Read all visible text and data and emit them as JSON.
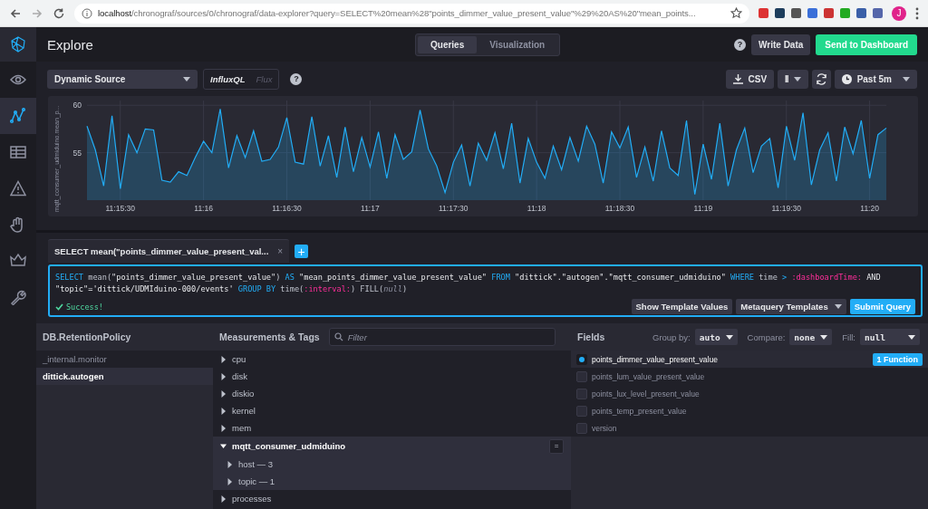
{
  "browser": {
    "url_host": "localhost",
    "url_path": "/chronograf/sources/0/chronograf/data-explorer?query=SELECT%20mean%28\"points_dimmer_value_present_value\"%29%20AS%20\"mean_points...",
    "avatar": "J"
  },
  "sidebar": {
    "items": [
      {
        "selected": false
      },
      {
        "selected": true
      },
      {
        "selected": false
      },
      {
        "selected": false
      },
      {
        "selected": false
      },
      {
        "selected": false
      },
      {
        "selected": false
      }
    ]
  },
  "header": {
    "title": "Explore",
    "tabs": [
      {
        "label": "Queries",
        "selected": true
      },
      {
        "label": "Visualization",
        "selected": false
      }
    ],
    "help": "?",
    "write_data": "Write Data",
    "send": "Send to Dashboard"
  },
  "toolbar": {
    "source": "Dynamic Source",
    "languages": [
      {
        "label": "InfluxQL",
        "selected": true
      },
      {
        "label": "Flux",
        "selected": false
      }
    ],
    "help": "?",
    "csv": "CSV",
    "pause": "II",
    "range": "Past 5m"
  },
  "chart": {
    "chart_data": {
      "type": "area",
      "ylabel": "mqtt_consumer_udmiduino.mean_p...",
      "ylim": [
        50,
        60.5
      ],
      "yticks": [
        55,
        60
      ],
      "grid": true,
      "categories": [
        null,
        null,
        null,
        null,
        "11:15:30",
        null,
        null,
        null,
        null,
        null,
        null,
        null,
        null,
        null,
        "11:16",
        null,
        null,
        null,
        null,
        null,
        null,
        null,
        null,
        null,
        "11:16:30",
        null,
        null,
        null,
        null,
        null,
        null,
        null,
        null,
        null,
        "11:17",
        null,
        null,
        null,
        null,
        null,
        null,
        null,
        null,
        null,
        "11:17:30",
        null,
        null,
        null,
        null,
        null,
        null,
        null,
        null,
        null,
        "11:18",
        null,
        null,
        null,
        null,
        null,
        null,
        null,
        null,
        null,
        "11:18:30",
        null,
        null,
        null,
        null,
        null,
        null,
        null,
        null,
        null,
        "11:19",
        null,
        null,
        null,
        null,
        null,
        null,
        null,
        null,
        null,
        "11:19:30",
        null,
        null,
        null,
        null,
        null,
        null,
        null,
        null,
        null,
        "11:20",
        null,
        null
      ],
      "series": [
        {
          "color": "#22adf6",
          "values": [
            57.8,
            55.3,
            51.5,
            58.9,
            51.2,
            56.9,
            55.0,
            57.5,
            57.4,
            52.1,
            51.9,
            53.0,
            52.6,
            54.5,
            56.2,
            55.0,
            59.6,
            53.4,
            56.8,
            54.5,
            57.3,
            54.1,
            54.3,
            55.6,
            58.7,
            54.0,
            53.8,
            58.8,
            53.6,
            56.8,
            52.4,
            57.7,
            53.0,
            56.6,
            53.5,
            57.2,
            52.3,
            56.9,
            54.3,
            55.1,
            59.5,
            55.4,
            53.6,
            50.8,
            54.0,
            55.8,
            51.5,
            56.0,
            54.2,
            57.1,
            53.3,
            58.1,
            51.8,
            56.5,
            54.0,
            52.3,
            55.7,
            53.2,
            56.6,
            54.1,
            57.8,
            55.9,
            51.8,
            57.2,
            55.5,
            57.7,
            52.4,
            55.6,
            52.0,
            57.3,
            53.4,
            52.6,
            58.4,
            50.6,
            55.9,
            52.2,
            58.1,
            51.5,
            55.3,
            57.6,
            52.9,
            55.7,
            56.5,
            51.3,
            57.8,
            54.2,
            59.2,
            51.6,
            55.3,
            57.1,
            52.0,
            57.7,
            54.9,
            58.4,
            52.3,
            56.9,
            57.6
          ]
        }
      ]
    }
  },
  "query_tabs": [
    {
      "label": "SELECT mean(\"points_dimmer_value_present_val...",
      "selected": true,
      "close": "×"
    }
  ],
  "add_query": "+",
  "editor": {
    "lines": [
      [
        {
          "kind": "keyword",
          "text": "SELECT"
        },
        {
          "kind": "plain",
          "text": " mean("
        },
        {
          "kind": "string",
          "text": "\"points_dimmer_value_present_value\""
        },
        {
          "kind": "plain",
          "text": ") "
        },
        {
          "kind": "keyword",
          "text": "AS"
        },
        {
          "kind": "string",
          "text": " \"mean_points_dimmer_value_present_value\" "
        },
        {
          "kind": "keyword",
          "text": "FROM"
        },
        {
          "kind": "string",
          "text": " \"dittick\".\"autogen\".\"mqtt_consumer_udmiduino\" "
        },
        {
          "kind": "keyword",
          "text": "WHERE"
        },
        {
          "kind": "plain",
          "text": " time "
        },
        {
          "kind": "keyword",
          "text": ">"
        },
        {
          "kind": "template",
          "text": " :dashboardTime:"
        },
        {
          "kind": "string",
          "text": " AND"
        }
      ],
      [
        {
          "kind": "string",
          "text": "\"topic\"='dittick/UDMIduino-000/events' "
        },
        {
          "kind": "keyword",
          "text": "GROUP BY"
        },
        {
          "kind": "plain",
          "text": " time("
        },
        {
          "kind": "template",
          "text": ":interval:"
        },
        {
          "kind": "plain",
          "text": ") FILL("
        },
        {
          "kind": "null",
          "text": "null"
        },
        {
          "kind": "plain",
          "text": ")"
        }
      ]
    ],
    "status": "Success!",
    "buttons": [
      "Show Template Values",
      "Metaquery Templates",
      "Submit Query"
    ]
  },
  "databases": {
    "title": "DB.RetentionPolicy",
    "items": [
      {
        "label": "_internal.monitor",
        "selected": false
      },
      {
        "label": "dittick.autogen",
        "selected": true
      }
    ]
  },
  "measurements": {
    "title": "Measurements & Tags",
    "filter_placeholder": "Filter",
    "items": [
      {
        "label": "cpu",
        "expanded": false
      },
      {
        "label": "disk",
        "expanded": false
      },
      {
        "label": "diskio",
        "expanded": false
      },
      {
        "label": "kernel",
        "expanded": false
      },
      {
        "label": "mem",
        "expanded": false
      },
      {
        "label": "mqtt_consumer_udmiduino",
        "expanded": true,
        "button": "=",
        "children": [
          {
            "label": "host — 3",
            "expanded": false
          },
          {
            "label": "topic — 1",
            "expanded": false
          }
        ]
      },
      {
        "label": "processes",
        "expanded": false
      }
    ]
  },
  "fields": {
    "title": "Fields",
    "group_by_label": "Group by:",
    "group_by": "auto",
    "compare_label": "Compare:",
    "compare": "none",
    "fill_label": "Fill:",
    "fill": "null",
    "items": [
      {
        "label": "points_dimmer_value_present_value",
        "checked": true,
        "function": "1 Function"
      },
      {
        "label": "points_lum_value_present_value",
        "checked": false
      },
      {
        "label": "points_lux_level_present_value",
        "checked": false
      },
      {
        "label": "points_temp_present_value",
        "checked": false
      },
      {
        "label": "version",
        "checked": false
      }
    ]
  }
}
